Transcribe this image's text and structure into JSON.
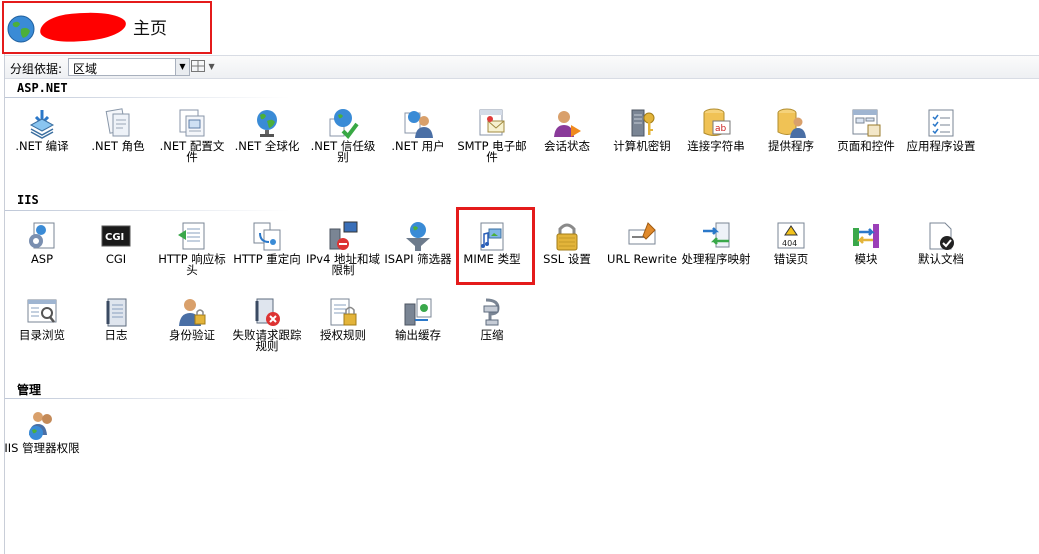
{
  "header": {
    "title": "主页"
  },
  "toolbar": {
    "group_by_label": "分组依据:",
    "group_by_value": "区域"
  },
  "sections": {
    "aspnet": {
      "title": "ASP.NET",
      "items": [
        {
          "label": ".NET 编译",
          "icon": "net-compilation-icon"
        },
        {
          "label": ".NET 角色",
          "icon": "net-roles-icon"
        },
        {
          "label": ".NET 配置文件",
          "icon": "net-profile-icon"
        },
        {
          "label": ".NET 全球化",
          "icon": "net-globalization-icon"
        },
        {
          "label": ".NET 信任级别",
          "icon": "net-trust-levels-icon"
        },
        {
          "label": ".NET 用户",
          "icon": "net-users-icon"
        },
        {
          "label": "SMTP 电子邮件",
          "icon": "smtp-email-icon"
        },
        {
          "label": "会话状态",
          "icon": "session-state-icon"
        },
        {
          "label": "计算机密钥",
          "icon": "machine-key-icon"
        },
        {
          "label": "连接字符串",
          "icon": "connection-strings-icon"
        },
        {
          "label": "提供程序",
          "icon": "providers-icon"
        },
        {
          "label": "页面和控件",
          "icon": "pages-controls-icon"
        },
        {
          "label": "应用程序设置",
          "icon": "app-settings-icon"
        }
      ]
    },
    "iis": {
      "title": "IIS",
      "items": [
        {
          "label": "ASP",
          "icon": "asp-icon"
        },
        {
          "label": "CGI",
          "icon": "cgi-icon"
        },
        {
          "label": "HTTP 响应标头",
          "icon": "http-response-headers-icon"
        },
        {
          "label": "HTTP 重定向",
          "icon": "http-redirect-icon"
        },
        {
          "label": "IPv4 地址和域限制",
          "icon": "ipv4-restrictions-icon"
        },
        {
          "label": "ISAPI 筛选器",
          "icon": "isapi-filters-icon"
        },
        {
          "label": "MIME 类型",
          "icon": "mime-types-icon"
        },
        {
          "label": "SSL 设置",
          "icon": "ssl-settings-icon"
        },
        {
          "label": "URL Rewrite",
          "icon": "url-rewrite-icon"
        },
        {
          "label": "处理程序映射",
          "icon": "handler-mappings-icon"
        },
        {
          "label": "错误页",
          "icon": "error-pages-icon"
        },
        {
          "label": "模块",
          "icon": "modules-icon"
        },
        {
          "label": "默认文档",
          "icon": "default-document-icon"
        },
        {
          "label": "目录浏览",
          "icon": "directory-browsing-icon"
        },
        {
          "label": "日志",
          "icon": "logging-icon"
        },
        {
          "label": "身份验证",
          "icon": "authentication-icon"
        },
        {
          "label": "失败请求跟踪规则",
          "icon": "failed-request-tracing-icon"
        },
        {
          "label": "授权规则",
          "icon": "authorization-rules-icon"
        },
        {
          "label": "输出缓存",
          "icon": "output-caching-icon"
        },
        {
          "label": "压缩",
          "icon": "compression-icon"
        }
      ]
    },
    "management": {
      "title": "管理",
      "items": [
        {
          "label": "IIS 管理器权限",
          "icon": "iis-manager-permissions-icon"
        }
      ]
    }
  },
  "colors": {
    "highlight": "#e41b1b",
    "accent": "#2b6cb0"
  }
}
